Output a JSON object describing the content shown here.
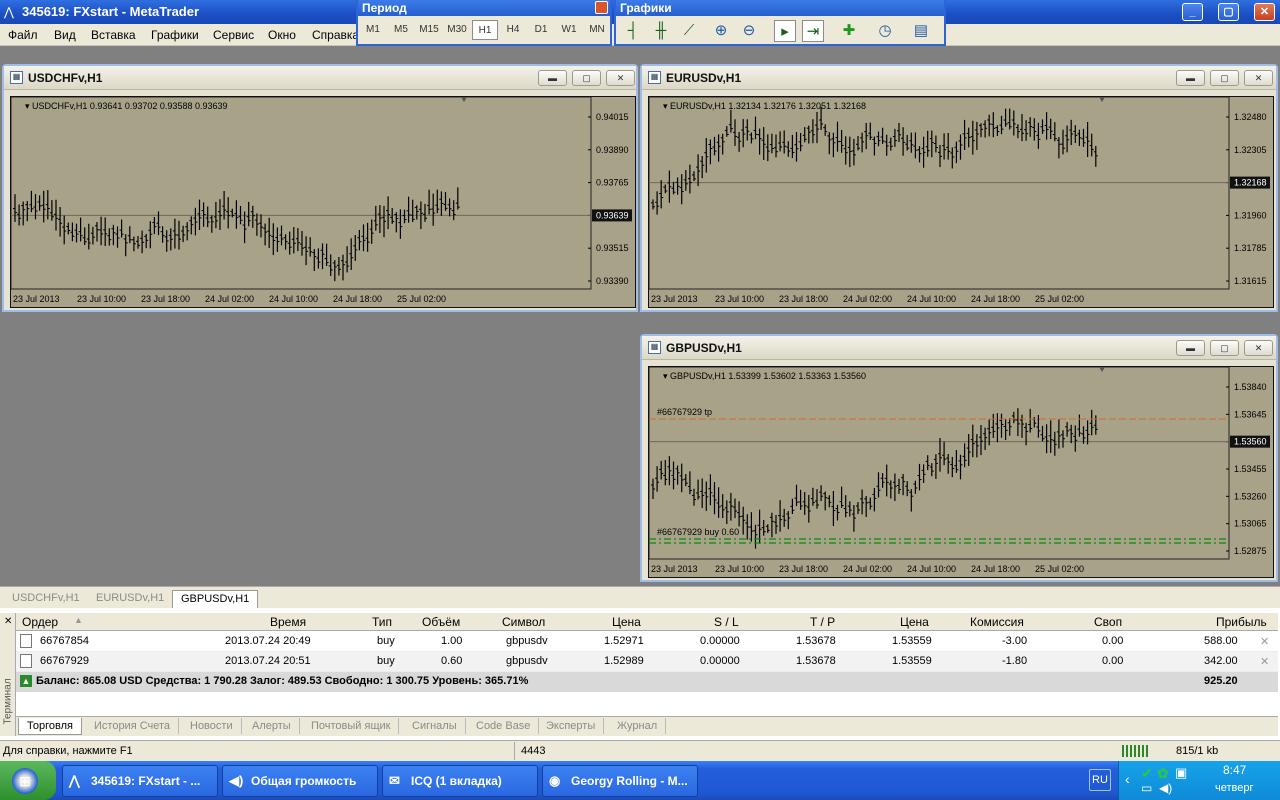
{
  "app": {
    "title": "345619: FXstart - MetaTrader"
  },
  "menu": [
    "Файл",
    "Вид",
    "Вставка",
    "Графики",
    "Сервис",
    "Окно",
    "Справка"
  ],
  "period_toolbar": {
    "title": "Период",
    "buttons": [
      "M1",
      "M5",
      "M15",
      "M30",
      "H1",
      "H4",
      "D1",
      "W1",
      "MN"
    ],
    "selected": "H1"
  },
  "charts_toolbar": {
    "title": "Графики",
    "icons": [
      "bar-chart-icon",
      "candlestick-icon",
      "line-chart-icon",
      "zoom-in-icon",
      "zoom-out-icon",
      "autoscroll-icon",
      "chart-shift-icon",
      "add-indicator-icon",
      "period-clock-icon",
      "template-icon"
    ]
  },
  "charts": [
    {
      "window_title": "USDCHFv,H1",
      "header": "USDCHFv,H1  0.93641 0.93702 0.93588 0.93639",
      "price_labels": [
        "0.94015",
        "0.93890",
        "0.93765",
        "0.93639",
        "0.93515",
        "0.93390"
      ],
      "current_price": "0.93639",
      "time_labels": [
        "23 Jul 2013",
        "23 Jul 10:00",
        "23 Jul 18:00",
        "24 Jul 02:00",
        "24 Jul 10:00",
        "24 Jul 18:00",
        "25 Jul 02:00"
      ],
      "orders": []
    },
    {
      "window_title": "EURUSDv,H1",
      "header": "EURUSDv,H1  1.32134 1.32176 1.32051 1.32168",
      "price_labels": [
        "1.32480",
        "1.32305",
        "1.32168",
        "1.31960",
        "1.31785",
        "1.31615"
      ],
      "current_price": "1.32168",
      "time_labels": [
        "23 Jul 2013",
        "23 Jul 10:00",
        "23 Jul 18:00",
        "24 Jul 02:00",
        "24 Jul 10:00",
        "24 Jul 18:00",
        "25 Jul 02:00"
      ],
      "orders": []
    },
    {
      "window_title": "GBPUSDv,H1",
      "header": "GBPUSDv,H1  1.53399 1.53602 1.53363 1.53560",
      "price_labels": [
        "1.53840",
        "1.53645",
        "1.53560",
        "1.53455",
        "1.53260",
        "1.53065",
        "1.52875"
      ],
      "current_price": "1.53560",
      "time_labels": [
        "23 Jul 2013",
        "23 Jul 10:00",
        "23 Jul 18:00",
        "24 Jul 02:00",
        "24 Jul 10:00",
        "24 Jul 18:00",
        "25 Jul 02:00"
      ],
      "orders": [
        "#66767929 tp",
        "#66767929 buy 0.60"
      ]
    }
  ],
  "dock_tabs": [
    "USDCHFv,H1",
    "EURUSDv,H1",
    "GBPUSDv,H1"
  ],
  "dock_selected": "GBPUSDv,H1",
  "terminal": {
    "side_label": "Терминал",
    "columns": [
      "Ордер",
      "Время",
      "Тип",
      "Объём",
      "Символ",
      "Цена",
      "S / L",
      "T / P",
      "Цена",
      "Комиссия",
      "Своп",
      "Прибыль"
    ],
    "rows": [
      [
        "66767854",
        "2013.07.24 20:49",
        "buy",
        "1.00",
        "gbpusdv",
        "1.52971",
        "0.00000",
        "1.53678",
        "1.53559",
        "-3.00",
        "0.00",
        "588.00"
      ],
      [
        "66767929",
        "2013.07.24 20:51",
        "buy",
        "0.60",
        "gbpusdv",
        "1.52989",
        "0.00000",
        "1.53678",
        "1.53559",
        "-1.80",
        "0.00",
        "342.00"
      ]
    ],
    "balance": "Баланс: 865.08 USD  Средства: 1 790.28  Залог: 489.53  Свободно: 1 300.75  Уровень: 365.71%",
    "total_profit": "925.20",
    "tabs": [
      "Торговля",
      "История Счета",
      "Новости",
      "Алерты",
      "Почтовый ящик",
      "Сигналы",
      "Code Base",
      "Эксперты",
      "Журнал"
    ],
    "selected_tab": "Торговля"
  },
  "status": {
    "help": "Для справки, нажмите F1",
    "value": "4443",
    "traffic": "815/1 kb"
  },
  "taskbar": {
    "tasks": [
      "345619: FXstart - ...",
      "Общая громкость",
      "ICQ (1 вкладка)",
      "Georgy Rolling - M..."
    ],
    "lang": "RU",
    "time": "8:47",
    "day": "четверг"
  },
  "colors": {
    "chart_bg": "#a8a289",
    "tp_line": "#d2691e",
    "buy_line": "#0a8a0a",
    "taskbar": "#245edb"
  }
}
